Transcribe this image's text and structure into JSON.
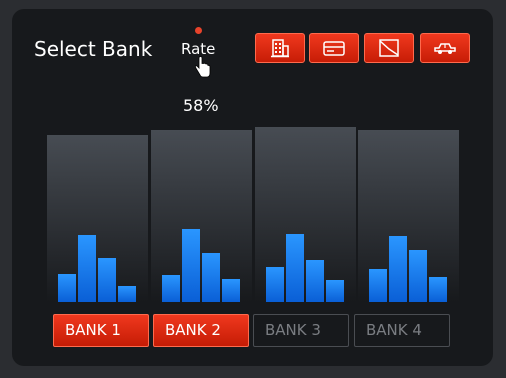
{
  "title": "Select Bank",
  "rate": {
    "label": "Rate",
    "percent_label": "58%"
  },
  "icons": [
    "bank-building-icon",
    "credit-card-icon",
    "chart-trend-icon",
    "car-icon"
  ],
  "banks": [
    {
      "label": "BANK 1",
      "selected": true,
      "bars": [
        0.28,
        0.67,
        0.44,
        0.16
      ]
    },
    {
      "label": "BANK 2",
      "selected": true,
      "bars": [
        0.27,
        0.73,
        0.49,
        0.23
      ]
    },
    {
      "label": "BANK 3",
      "selected": false,
      "bars": [
        0.35,
        0.68,
        0.42,
        0.22
      ]
    },
    {
      "label": "BANK 4",
      "selected": false,
      "bars": [
        0.33,
        0.66,
        0.52,
        0.25
      ]
    }
  ],
  "colors": {
    "accent": "#e8321a",
    "bar": "#1a7ff0",
    "card": "#17191c"
  }
}
